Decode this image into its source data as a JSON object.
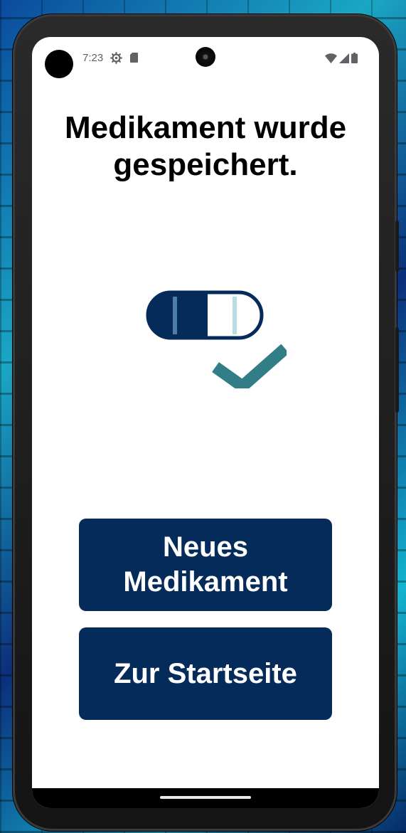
{
  "status_bar": {
    "time": "7:23",
    "icons": [
      "settings-gear-icon",
      "sd-card-icon",
      "wifi-icon",
      "cell-signal-icon",
      "battery-icon"
    ]
  },
  "screen": {
    "title": "Medikament wurde gespeichert.",
    "illustration": "pill-capsule-with-checkmark",
    "colors": {
      "button_bg": "#042b5a",
      "capsule_dark": "#042b5a",
      "capsule_line_dark": "#4d7ea3",
      "capsule_line_light": "#b7dde6",
      "checkmark": "#317e86"
    }
  },
  "buttons": {
    "new_medication": "Neues Medikament",
    "to_home": "Zur Startseite"
  }
}
